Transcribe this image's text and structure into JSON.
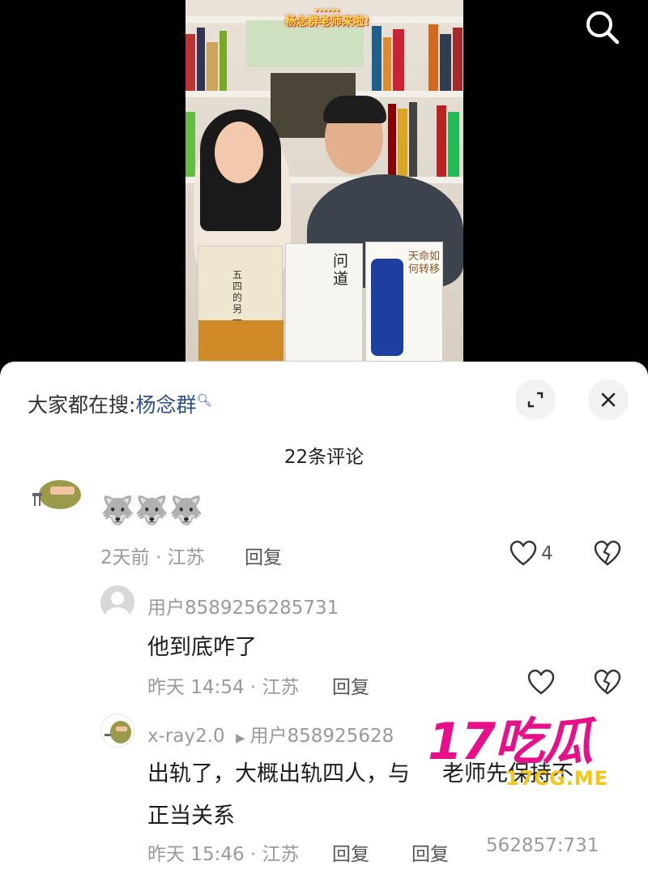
{
  "video": {
    "caption_line1": "......",
    "caption_line2": "杨念群老师来啦!",
    "book1_title": "五四的另一面",
    "book2_title": "问道",
    "book3_title": "天命如何转移"
  },
  "sheet": {
    "search_prefix": "大家都在搜:",
    "search_keyword": "杨念群",
    "comment_count": "22条评论"
  },
  "comments": [
    {
      "text": "🐺🐺🐺",
      "time_location": "2天前 · 江苏",
      "reply_label": "回复",
      "likes": "4"
    }
  ],
  "replies": [
    {
      "username": "用户8589256285731",
      "text": "他到底咋了",
      "time_location": "昨天 14:54 · 江苏",
      "reply_label": "回复"
    },
    {
      "username": "x-ray2.0",
      "reply_to": "用户858925628",
      "text_line1": "出轨了，大概出轨四人，与",
      "text_line1b": "老师先保持不",
      "text_line2": "正当关系",
      "time_location": "昨天 15:46 · 江苏",
      "reply_label": "回复",
      "reply_label2": "回复",
      "trailing": "562857:731"
    }
  ],
  "watermark": {
    "big": "17吃瓜",
    "small": "17CG.ME"
  },
  "colors": {
    "keyword": "#2b4e8c",
    "meta": "#9a9a9a",
    "watermark": "#e8108a",
    "watermark_small": "#f5c518"
  }
}
